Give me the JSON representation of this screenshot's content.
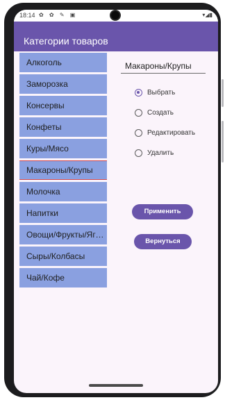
{
  "status": {
    "time": "18:14",
    "icons_left": "✿ ✿ ✎ ▣",
    "icons_right": "▾◢▮"
  },
  "app": {
    "title": "Категории товаров"
  },
  "categories": [
    "Алкоголь",
    "Заморозка",
    "Консервы",
    "Конфеты",
    "Куры/Мясо",
    "Макароны/Крупы",
    "Молочка",
    "Напитки",
    "Овощи/Фрукты/Ягоды",
    "Сыры/Колбасы",
    "Чай/Кофе"
  ],
  "selected_category": "Макароны/Крупы",
  "actions": {
    "options": [
      "Выбрать",
      "Создать",
      "Редактировать",
      "Удалить"
    ],
    "checked": "Выбрать"
  },
  "buttons": {
    "apply": "Применить",
    "back": "Вернуться"
  },
  "colors": {
    "primary": "#6a55ab",
    "list_item": "#8aa0e0",
    "selected_border": "#d0484c"
  }
}
